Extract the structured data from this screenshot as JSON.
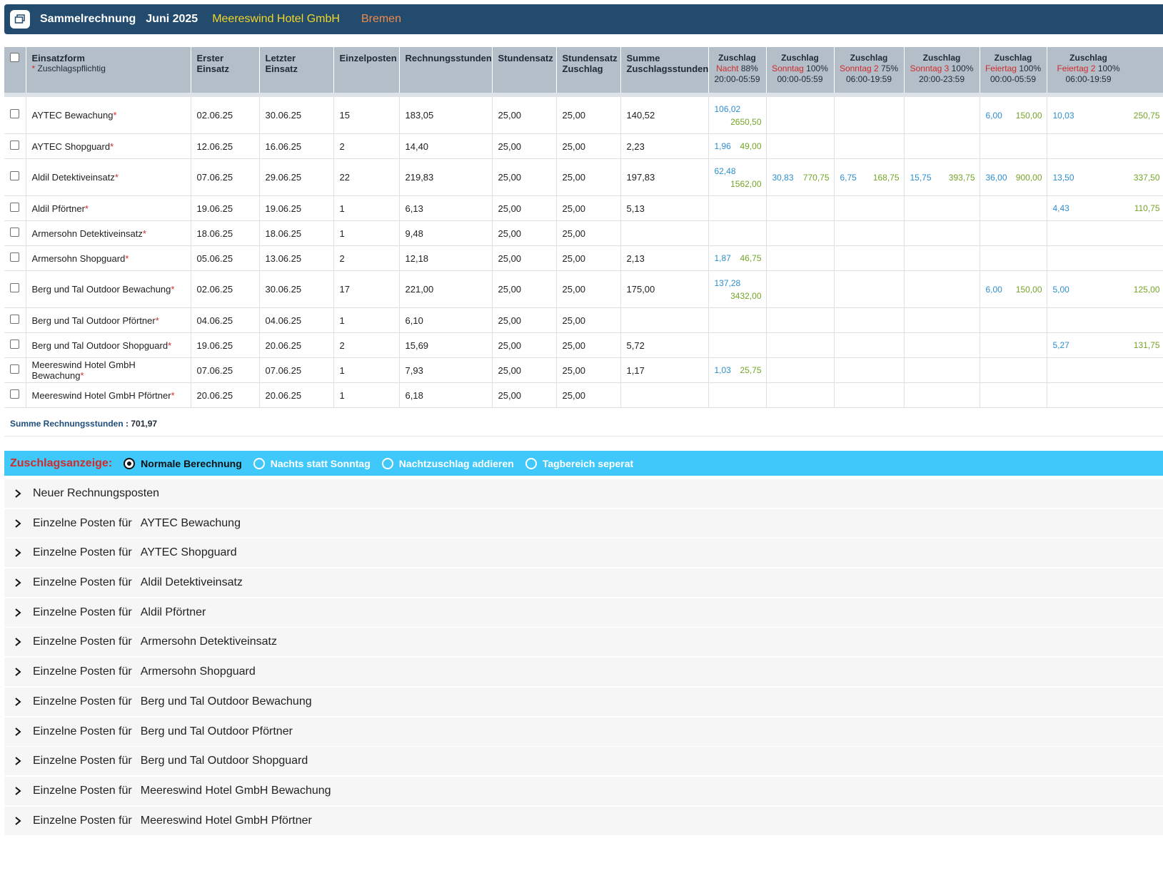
{
  "header": {
    "title": "Sammelrechnung",
    "month": "Juni 2025",
    "company": "Meereswind Hotel GmbH",
    "city": "Bremen",
    "icon": "window-restore-icon"
  },
  "table": {
    "col_einsatzform": "Einsatzform",
    "col_einsatzform_note": "Zuschlagspflichtig",
    "col_erster": "Erster Einsatz",
    "col_letzter": "Letzter Einsatz",
    "col_einzelposten": "Einzelposten",
    "col_rechnungsstunden": "Rechnungsstunden",
    "col_stundensatz": "Stundensatz",
    "col_stundensatz_zuschlag": "Stundensatz Zuschlag",
    "col_summe_zuschlagsstunden": "Summe Zuschlagsstunden",
    "zuschlag_cols": [
      {
        "head": "Zuschlag",
        "kind": "Nacht",
        "pct": "88%",
        "range": "20:00-05:59"
      },
      {
        "head": "Zuschlag",
        "kind": "Sonntag",
        "pct": "100%",
        "range": "00:00-05:59"
      },
      {
        "head": "Zuschlag",
        "kind": "Sonntag 2",
        "pct": "75%",
        "range": "06:00-19:59"
      },
      {
        "head": "Zuschlag",
        "kind": "Sonntag 3",
        "pct": "100%",
        "range": "20:00-23:59"
      },
      {
        "head": "Zuschlag",
        "kind": "Feiertag",
        "pct": "100%",
        "range": "00:00-05:59"
      },
      {
        "head": "Zuschlag",
        "kind": "Feiertag 2",
        "pct": "100%",
        "range": "06:00-19:59"
      }
    ],
    "rows": [
      {
        "name": "AYTEC Bewachung",
        "erster": "02.06.25",
        "letzter": "30.06.25",
        "einzel": "15",
        "rstd": "183,05",
        "satz": "25,00",
        "satz_z": "25,00",
        "summe": "140,52",
        "z": [
          {
            "h": "106,02",
            "a": "2650,50"
          },
          {
            "h": "",
            "a": ""
          },
          {
            "h": "",
            "a": ""
          },
          {
            "h": "",
            "a": ""
          },
          {
            "h": "6,00",
            "a": "150,00"
          },
          {
            "h": "10,03",
            "a": "250,75"
          }
        ]
      },
      {
        "name": "AYTEC Shopguard",
        "erster": "12.06.25",
        "letzter": "16.06.25",
        "einzel": "2",
        "rstd": "14,40",
        "satz": "25,00",
        "satz_z": "25,00",
        "summe": "2,23",
        "z": [
          {
            "h": "1,96",
            "a": "49,00"
          },
          {
            "h": "",
            "a": ""
          },
          {
            "h": "",
            "a": ""
          },
          {
            "h": "",
            "a": ""
          },
          {
            "h": "",
            "a": ""
          },
          {
            "h": "",
            "a": ""
          }
        ]
      },
      {
        "name": "Aldil Detektiveinsatz",
        "erster": "07.06.25",
        "letzter": "29.06.25",
        "einzel": "22",
        "rstd": "219,83",
        "satz": "25,00",
        "satz_z": "25,00",
        "summe": "197,83",
        "z": [
          {
            "h": "62,48",
            "a": "1562,00"
          },
          {
            "h": "30,83",
            "a": "770,75"
          },
          {
            "h": "6,75",
            "a": "168,75"
          },
          {
            "h": "15,75",
            "a": "393,75"
          },
          {
            "h": "36,00",
            "a": "900,00"
          },
          {
            "h": "13,50",
            "a": "337,50"
          }
        ]
      },
      {
        "name": "Aldil Pförtner",
        "erster": "19.06.25",
        "letzter": "19.06.25",
        "einzel": "1",
        "rstd": "6,13",
        "satz": "25,00",
        "satz_z": "25,00",
        "summe": "5,13",
        "z": [
          {
            "h": "",
            "a": ""
          },
          {
            "h": "",
            "a": ""
          },
          {
            "h": "",
            "a": ""
          },
          {
            "h": "",
            "a": ""
          },
          {
            "h": "",
            "a": ""
          },
          {
            "h": "4,43",
            "a": "110,75"
          }
        ]
      },
      {
        "name": "Armersohn Detektiveinsatz",
        "erster": "18.06.25",
        "letzter": "18.06.25",
        "einzel": "1",
        "rstd": "9,48",
        "satz": "25,00",
        "satz_z": "25,00",
        "summe": "",
        "z": [
          {
            "h": "",
            "a": ""
          },
          {
            "h": "",
            "a": ""
          },
          {
            "h": "",
            "a": ""
          },
          {
            "h": "",
            "a": ""
          },
          {
            "h": "",
            "a": ""
          },
          {
            "h": "",
            "a": ""
          }
        ]
      },
      {
        "name": "Armersohn Shopguard",
        "erster": "05.06.25",
        "letzter": "13.06.25",
        "einzel": "2",
        "rstd": "12,18",
        "satz": "25,00",
        "satz_z": "25,00",
        "summe": "2,13",
        "z": [
          {
            "h": "1,87",
            "a": "46,75"
          },
          {
            "h": "",
            "a": ""
          },
          {
            "h": "",
            "a": ""
          },
          {
            "h": "",
            "a": ""
          },
          {
            "h": "",
            "a": ""
          },
          {
            "h": "",
            "a": ""
          }
        ]
      },
      {
        "name": "Berg und Tal Outdoor Bewachung",
        "erster": "02.06.25",
        "letzter": "30.06.25",
        "einzel": "17",
        "rstd": "221,00",
        "satz": "25,00",
        "satz_z": "25,00",
        "summe": "175,00",
        "z": [
          {
            "h": "137,28",
            "a": "3432,00"
          },
          {
            "h": "",
            "a": ""
          },
          {
            "h": "",
            "a": ""
          },
          {
            "h": "",
            "a": ""
          },
          {
            "h": "6,00",
            "a": "150,00"
          },
          {
            "h": "5,00",
            "a": "125,00"
          }
        ]
      },
      {
        "name": "Berg und Tal Outdoor Pförtner",
        "erster": "04.06.25",
        "letzter": "04.06.25",
        "einzel": "1",
        "rstd": "6,10",
        "satz": "25,00",
        "satz_z": "25,00",
        "summe": "",
        "z": [
          {
            "h": "",
            "a": ""
          },
          {
            "h": "",
            "a": ""
          },
          {
            "h": "",
            "a": ""
          },
          {
            "h": "",
            "a": ""
          },
          {
            "h": "",
            "a": ""
          },
          {
            "h": "",
            "a": ""
          }
        ]
      },
      {
        "name": "Berg und Tal Outdoor Shopguard",
        "erster": "19.06.25",
        "letzter": "20.06.25",
        "einzel": "2",
        "rstd": "15,69",
        "satz": "25,00",
        "satz_z": "25,00",
        "summe": "5,72",
        "z": [
          {
            "h": "",
            "a": ""
          },
          {
            "h": "",
            "a": ""
          },
          {
            "h": "",
            "a": ""
          },
          {
            "h": "",
            "a": ""
          },
          {
            "h": "",
            "a": ""
          },
          {
            "h": "5,27",
            "a": "131,75"
          }
        ]
      },
      {
        "name": "Meereswind Hotel GmbH Bewachung",
        "erster": "07.06.25",
        "letzter": "07.06.25",
        "einzel": "1",
        "rstd": "7,93",
        "satz": "25,00",
        "satz_z": "25,00",
        "summe": "1,17",
        "z": [
          {
            "h": "1,03",
            "a": "25,75"
          },
          {
            "h": "",
            "a": ""
          },
          {
            "h": "",
            "a": ""
          },
          {
            "h": "",
            "a": ""
          },
          {
            "h": "",
            "a": ""
          },
          {
            "h": "",
            "a": ""
          }
        ]
      },
      {
        "name": "Meereswind Hotel GmbH Pförtner",
        "erster": "20.06.25",
        "letzter": "20.06.25",
        "einzel": "1",
        "rstd": "6,18",
        "satz": "25,00",
        "satz_z": "25,00",
        "summe": "",
        "z": [
          {
            "h": "",
            "a": ""
          },
          {
            "h": "",
            "a": ""
          },
          {
            "h": "",
            "a": ""
          },
          {
            "h": "",
            "a": ""
          },
          {
            "h": "",
            "a": ""
          },
          {
            "h": "",
            "a": ""
          }
        ]
      }
    ]
  },
  "summary": {
    "label": "Summe Rechnungsstunden",
    "sep": ":",
    "value": "701,97"
  },
  "zuschlag": {
    "label": "Zuschlagsanzeige:",
    "options": [
      {
        "label": "Normale Berechnung",
        "selected": true
      },
      {
        "label": "Nachts statt Sonntag",
        "selected": false
      },
      {
        "label": "Nachtzuschlag addieren",
        "selected": false
      },
      {
        "label": "Tagbereich seperat",
        "selected": false
      }
    ]
  },
  "accordion": {
    "prefix": "Einzelne Posten für",
    "first": "Neuer Rechnungsposten",
    "items": [
      "AYTEC Bewachung",
      "AYTEC Shopguard",
      "Aldil Detektiveinsatz",
      "Aldil Pförtner",
      "Armersohn Detektiveinsatz",
      "Armersohn Shopguard",
      "Berg und Tal Outdoor Bewachung",
      "Berg und Tal Outdoor Pförtner",
      "Berg und Tal Outdoor Shopguard",
      "Meereswind Hotel GmbH Bewachung",
      "Meereswind Hotel GmbH Pförtner"
    ]
  },
  "colors": {
    "header_bg": "#234b6e",
    "bar_bg": "#40c8fa",
    "hours": "#2d8ed0",
    "amount": "#74a526",
    "accent_red": "#d12b2b"
  }
}
